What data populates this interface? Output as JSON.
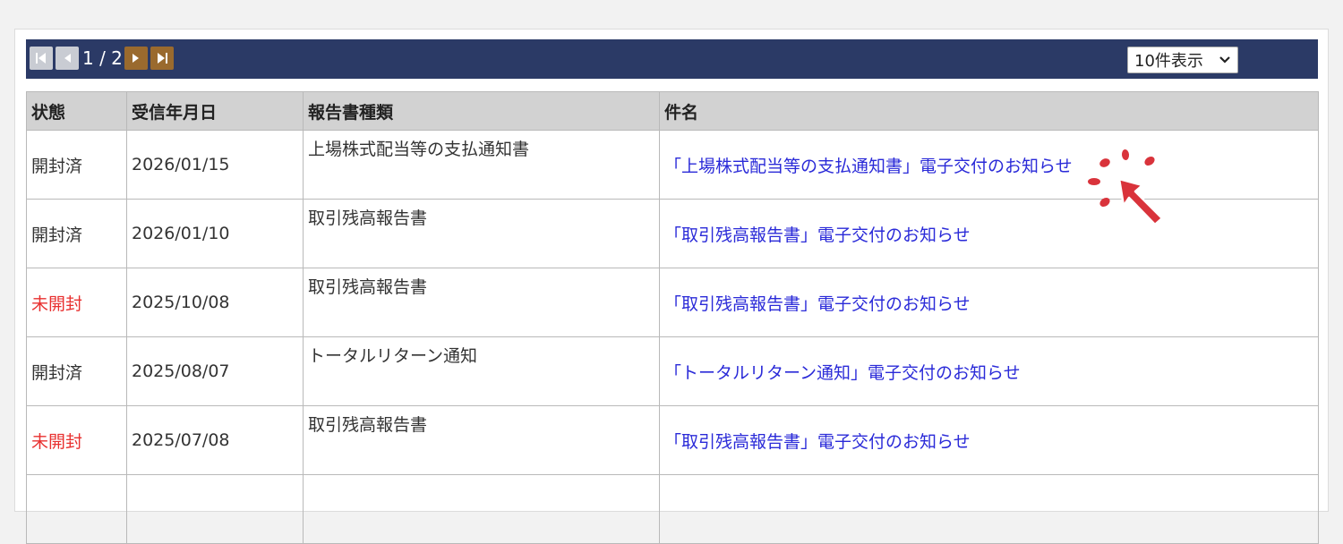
{
  "pager": {
    "page_info": "1 / 2",
    "first_icon": "first-page-icon",
    "prev_icon": "prev-page-icon",
    "next_icon": "next-page-icon",
    "last_icon": "last-page-icon"
  },
  "per_page": {
    "selected": "10件表示"
  },
  "table": {
    "headers": [
      "状態",
      "受信年月日",
      "報告書種類",
      "件名"
    ],
    "rows": [
      {
        "status": "開封済",
        "status_state": "opened",
        "date": "2026/01/15",
        "type": "上場株式配当等の支払通知書",
        "subject": "「上場株式配当等の支払通知書」電子交付のお知らせ"
      },
      {
        "status": "開封済",
        "status_state": "opened",
        "date": "2026/01/10",
        "type": "取引残高報告書",
        "subject": "「取引残高報告書」電子交付のお知らせ"
      },
      {
        "status": "未開封",
        "status_state": "unopened",
        "date": "2025/10/08",
        "type": "取引残高報告書",
        "subject": "「取引残高報告書」電子交付のお知らせ"
      },
      {
        "status": "開封済",
        "status_state": "opened",
        "date": "2025/08/07",
        "type": "トータルリターン通知",
        "subject": "「トータルリターン通知」電子交付のお知らせ"
      },
      {
        "status": "未開封",
        "status_state": "unopened",
        "date": "2025/07/08",
        "type": "取引残高報告書",
        "subject": "「取引残高報告書」電子交付のお知らせ"
      }
    ]
  },
  "colors": {
    "toolbar_bg": "#2b3a66",
    "link": "#2a2ad8",
    "unopened": "#e8302f",
    "cursor_red": "#d9333b"
  },
  "overlay_icon": "click-pointer-icon"
}
